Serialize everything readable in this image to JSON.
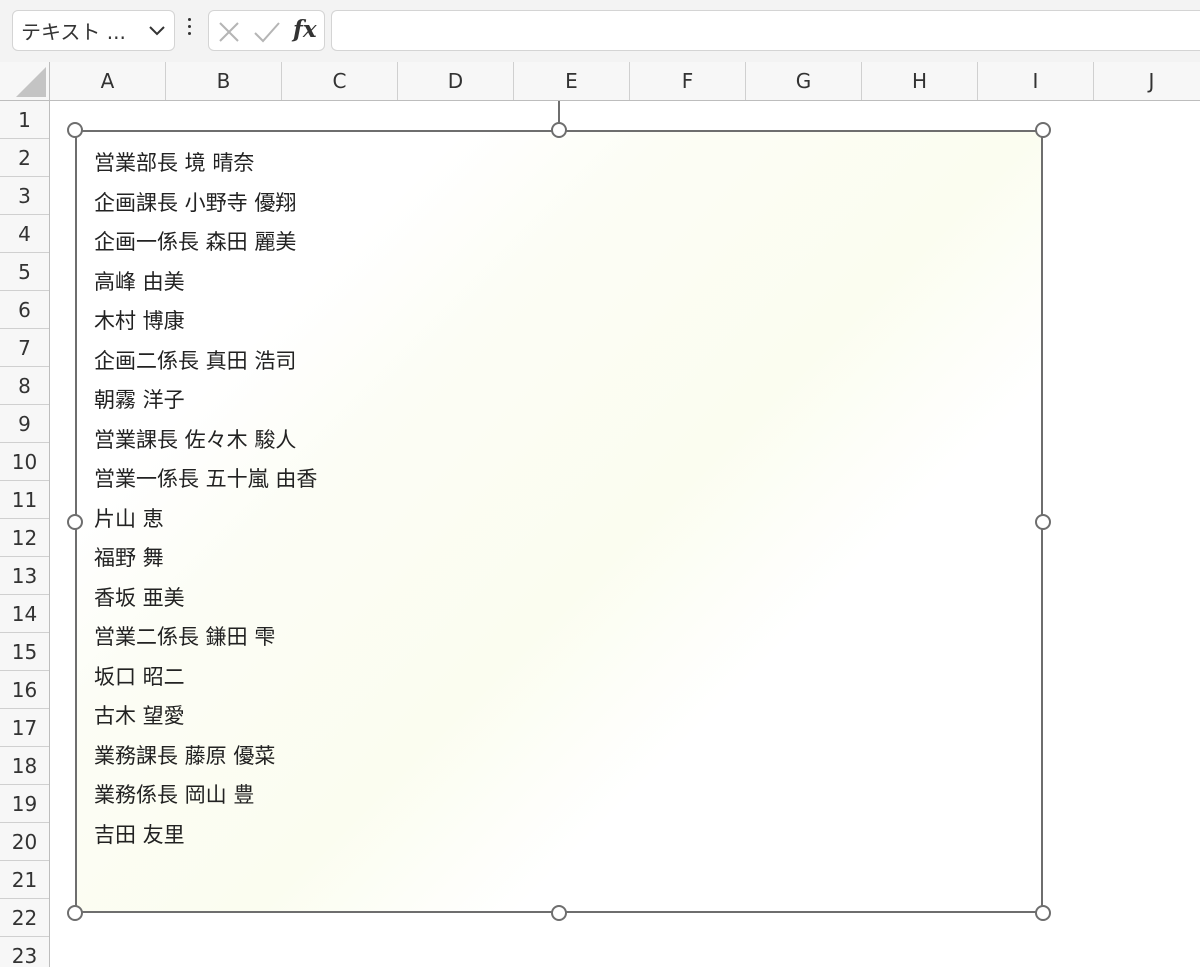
{
  "name_box": {
    "value": "テキスト ..."
  },
  "formula_bar": {
    "value": ""
  },
  "columns": [
    "A",
    "B",
    "C",
    "D",
    "E",
    "F",
    "G",
    "H",
    "I",
    "J"
  ],
  "rows": [
    "1",
    "2",
    "3",
    "4",
    "5",
    "6",
    "7",
    "8",
    "9",
    "10",
    "11",
    "12",
    "13",
    "14",
    "15",
    "16",
    "17",
    "18",
    "19",
    "20",
    "21",
    "22",
    "23"
  ],
  "text_box": {
    "lines": [
      "営業部長 境 晴奈",
      "企画課長 小野寺 優翔",
      "企画一係長 森田 麗美",
      "高峰 由美",
      "木村 博康",
      "企画二係長 真田 浩司",
      "朝霧 洋子",
      "営業課長 佐々木 駿人",
      "営業一係長 五十嵐 由香",
      "片山 恵",
      "福野 舞",
      "香坂 亜美",
      "営業二係長 鎌田 雫",
      "坂口 昭二",
      "古木 望愛",
      "業務課長 藤原 優菜",
      "業務係長 岡山 豊",
      "吉田 友里"
    ]
  },
  "colors": {
    "shape_border": "#6e6e6e",
    "header_bg": "#f7f7f7",
    "toolbar_bg": "#f3f3f3"
  }
}
